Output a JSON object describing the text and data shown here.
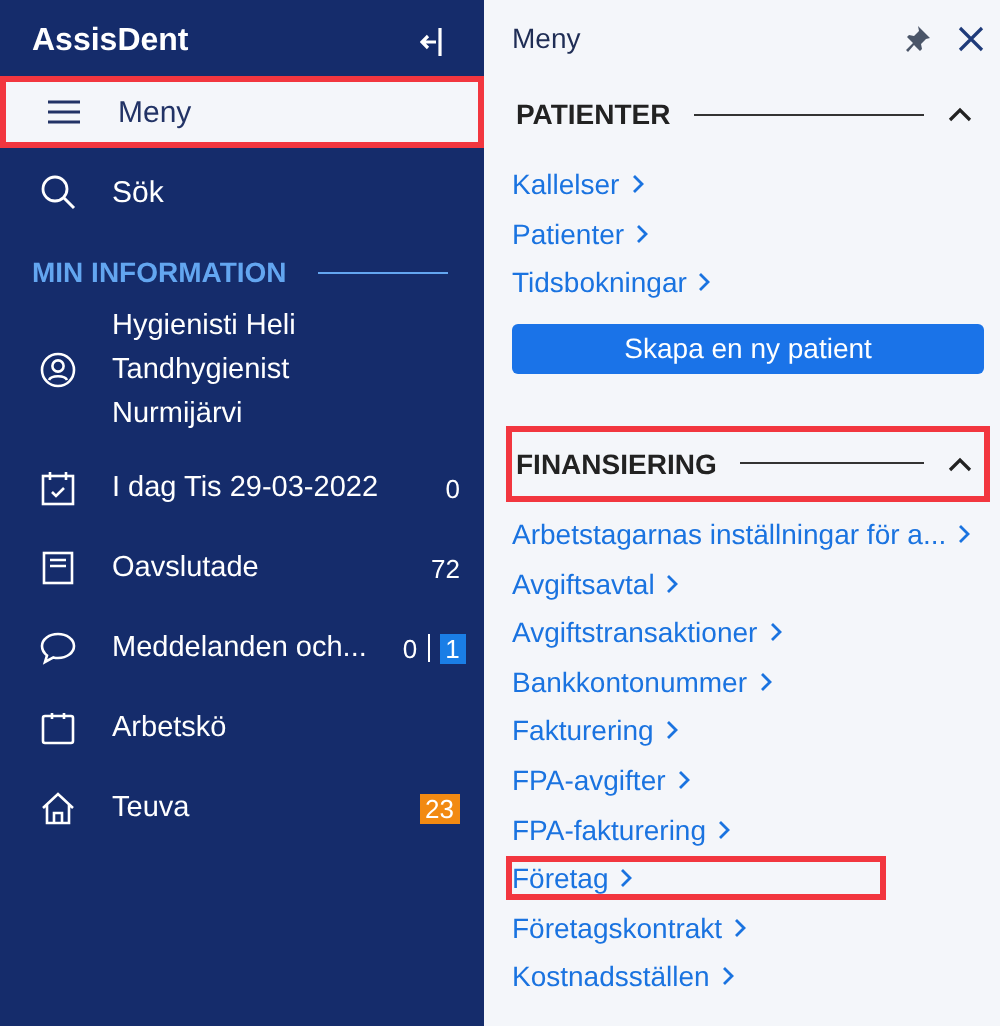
{
  "sidebar": {
    "title": "AssisDent",
    "items": [
      {
        "label": "Meny",
        "selected": true,
        "highlighted": true
      },
      {
        "label": "Sök",
        "selected": false,
        "highlighted": false
      }
    ],
    "section": "MIN INFORMATION",
    "profile": {
      "lines": [
        "Hygienisti Heli",
        "Tandhygienist",
        "Nurmijärvi"
      ]
    },
    "info_items": [
      {
        "label": "I dag Tis 29-03-2022",
        "counts": [
          {
            "text": "0",
            "kind": "plain"
          }
        ]
      },
      {
        "label": "Oavslutade",
        "counts": [
          {
            "text": "72",
            "kind": "plain"
          }
        ]
      },
      {
        "label": "Meddelanden och...",
        "counts": [
          {
            "text": "0",
            "kind": "plain"
          },
          {
            "text": "1",
            "kind": "badge",
            "color": "#1a7ee6"
          }
        ]
      },
      {
        "label": "Arbetskö"
      },
      {
        "label": "Teuva",
        "counts": [
          {
            "text": "23",
            "kind": "badge",
            "color": "#f28a12"
          }
        ]
      }
    ]
  },
  "panel": {
    "title": "Meny",
    "sections": [
      {
        "title": "PATIENTER",
        "expanded": true,
        "highlighted": false,
        "links": [
          {
            "label": "Kallelser",
            "highlighted": false
          },
          {
            "label": "Patienter",
            "highlighted": false
          },
          {
            "label": "Tidsbokningar",
            "highlighted": false
          }
        ],
        "button": "Skapa en ny patient"
      },
      {
        "title": "FINANSIERING",
        "expanded": true,
        "highlighted": true,
        "links": [
          {
            "label": "Arbetstagarnas inställningar för a...",
            "highlighted": false
          },
          {
            "label": "Avgiftsavtal",
            "highlighted": false
          },
          {
            "label": "Avgiftstransaktioner",
            "highlighted": false
          },
          {
            "label": "Bankkontonummer",
            "highlighted": false
          },
          {
            "label": "Fakturering",
            "highlighted": false
          },
          {
            "label": "FPA-avgifter",
            "highlighted": false
          },
          {
            "label": "FPA-fakturering",
            "highlighted": false
          },
          {
            "label": "Företag",
            "highlighted": true
          },
          {
            "label": "Företagskontrakt",
            "highlighted": false
          },
          {
            "label": "Kostnadsställen",
            "highlighted": false
          }
        ]
      }
    ]
  }
}
